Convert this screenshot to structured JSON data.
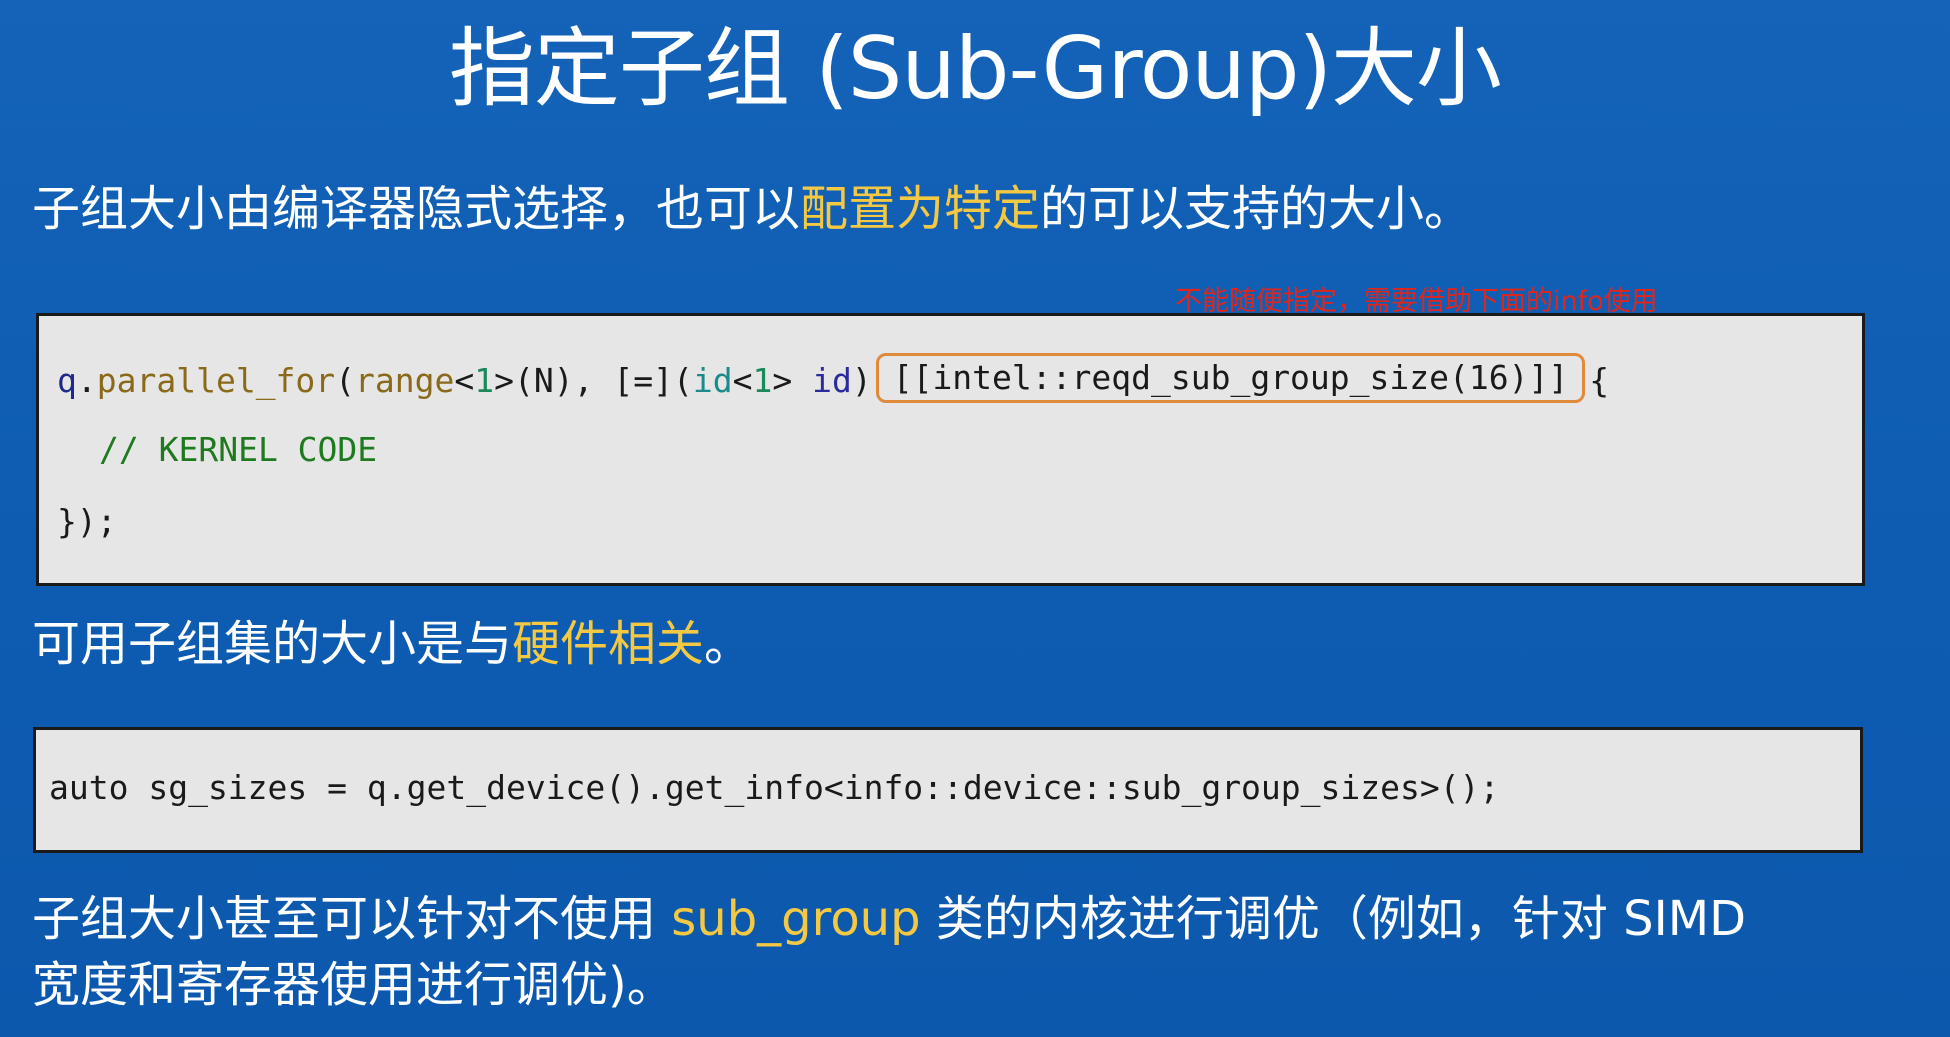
{
  "slide": {
    "title": "指定子组 (Sub-Group)大小",
    "line1": {
      "before": "子组大小由编译器隐式选择，也可以",
      "highlight": "配置为特定",
      "after": "的可以支持的大小。"
    },
    "annotation": "不能随便指定，需要借助下面的info使用",
    "code1": {
      "l1_q": "q",
      "l1_dot": ".",
      "l1_fn": "parallel_for",
      "l1_p1": "(",
      "l1_range": "range",
      "l1_lt": "<",
      "l1_one": "1",
      "l1_rest1": ">(N), [=](",
      "l1_id_type": "id",
      "l1_lt2": "<",
      "l1_one2": "1",
      "l1_gt2": "> ",
      "l1_id_var": "id",
      "l1_close": ")",
      "l1_attr": "[[intel::reqd_sub_group_size(16)]]",
      "l1_brace": "{",
      "l2_comment": "// KERNEL CODE",
      "l3": "});"
    },
    "line2": {
      "before": "可用子组集的大小是与",
      "highlight": "硬件相关",
      "after": "。"
    },
    "code2": {
      "line": "auto sg_sizes = q.get_device().get_info<info::device::sub_group_sizes>();"
    },
    "line3": {
      "before": "子组大小甚至可以针对不使用 ",
      "highlight": "sub_group",
      "after": " 类的内核进行调优（例如，针对 SIMD"
    },
    "line4": "宽度和寄存器使用进行调优)。",
    "colors": {
      "background": "#0f5fb5",
      "highlight": "#f4c842",
      "annotation": "#e0261c",
      "attr_border": "#e08a3c",
      "code_bg": "#e6e6e6"
    }
  }
}
